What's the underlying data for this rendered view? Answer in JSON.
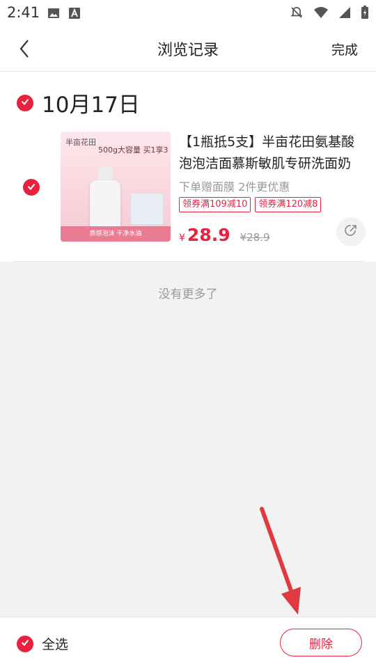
{
  "status": {
    "time": "2:41"
  },
  "header": {
    "title": "浏览记录",
    "done_label": "完成"
  },
  "group": {
    "date": "10月17日"
  },
  "product": {
    "title": "【1瓶抵5支】半亩花田氨基酸泡泡洁面慕斯敏肌专研洗面奶",
    "gift": "下单赠面膜 2件更优惠",
    "coupons": [
      "领券满109减10",
      "领券满120减8"
    ],
    "currency": "¥",
    "price": "28.9",
    "original_price": "¥28.9",
    "thumb_brand": "半亩花田",
    "thumb_promo": "500g大容量 买1享3",
    "thumb_strip": "质感泡沫 干净水油"
  },
  "list_end_text": "没有更多了",
  "footer": {
    "select_all_label": "全选",
    "delete_label": "删除"
  },
  "colors": {
    "accent": "#e8213f"
  }
}
